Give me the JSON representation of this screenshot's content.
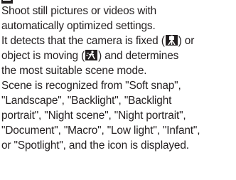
{
  "lines": [
    "Shoot still pictures or videos with",
    "automatically optimized settings.",
    "It detects that the camera is fixed (",
    ") or",
    "object is moving (",
    ") and determines",
    "the most suitable scene mode.",
    "Scene is recognized from \"Soft snap\",",
    "\"Landscape\", \"Backlight\", \"Backlight",
    "portrait\", \"Night scene\", \"Night portrait\",",
    "\"Document\", \"Macro\", \"Low light\", \"Infant\",",
    "or \"Spotlight\", and the icon is displayed."
  ],
  "icons": {
    "header": "auto-mode-icon",
    "fixed": "tripod-icon",
    "moving": "moving-person-icon"
  }
}
